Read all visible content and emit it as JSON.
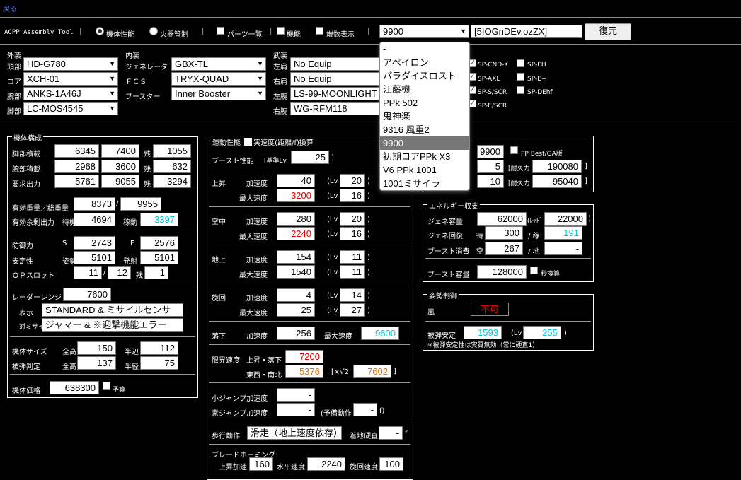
{
  "nav": {
    "back": "戻る"
  },
  "toolbar": {
    "title": "ACPP Assembly Tool",
    "radio_perf": "機体性能",
    "radio_fcs": "火器管制",
    "cb_parts": "パーツ一覧",
    "cb_func": "機能",
    "cb_decimal": "端数表示",
    "budget_value": "9900",
    "code_value": "[5IOGnDEv,ozZX]",
    "restore_button": "復元"
  },
  "dropdown": {
    "options": [
      "-",
      "アペイロン",
      "パラダイスロスト",
      "江藤機",
      "PPk 502",
      "鬼神楽",
      "9316 風重2",
      "9900",
      "初期コアPPk X3",
      "V6 PPk 1001",
      "1001ミサイラ"
    ],
    "selected": "9900"
  },
  "parts": {
    "exterior_label": "外装",
    "interior_label": "内装",
    "weapons_label": "武装",
    "head_label": "頭部",
    "head": "HD-G780",
    "core_label": "コア",
    "core": "XCH-01",
    "arms_label": "腕部",
    "arms": "ANKS-1A46J",
    "legs_label": "脚部",
    "legs": "LC-MOS4545",
    "gen_label": "ジェネレータ",
    "gen": "GBX-TL",
    "fcs_label": "ＦＣＳ",
    "fcs": "TRYX-QUAD",
    "booster_label": "ブースター",
    "booster": "Inner Booster",
    "ls_label": "左肩",
    "ls": "No Equip",
    "rs_label": "右肩",
    "rs": "No Equip",
    "la_label": "左腕",
    "la": "LS-99-MOONLIGHT",
    "ra_label": "右腕",
    "ra": "WG-RFM118"
  },
  "options": [
    "SP-CND-K",
    "SP-EH",
    "SP-AXL",
    "SP-E+",
    "SP-S/SCR",
    "SP-DEhf",
    "SP-E/SCR"
  ],
  "frame": {
    "legend": "機体構成",
    "leg_load_label": "脚部積載",
    "leg_load": "6345",
    "leg_load_max": "7400",
    "rem": "残",
    "leg_load_rem": "1055",
    "arm_load_label": "腕部積載",
    "arm_load": "2968",
    "arm_load_max": "3600",
    "arm_load_rem": "632",
    "power_label": "要求出力",
    "power": "5761",
    "power_max": "9055",
    "power_rem": "3294",
    "weight_label": "有効重量／総重量",
    "weight": "8373",
    "weight_total": "9955",
    "surplus_label": "有効余剰出力",
    "standby": "待機",
    "surplus_standby": "4694",
    "active": "稼動",
    "surplus_active": "3397",
    "defense_label": "防御力",
    "def_s": "S",
    "def_s_val": "2743",
    "def_e": "E",
    "def_e_val": "2576",
    "stability_label": "安定性",
    "posture": "姿勢",
    "stab_posture": "5101",
    "fire": "発射",
    "stab_fire": "5101",
    "op_label": "ＯＰスロット",
    "op_used": "11",
    "op_max": "12",
    "op_rem": "1",
    "radar_label": "レーダーレンジ",
    "radar": "7600",
    "display_label": "表示",
    "display": "STANDARD & ミサイルセンサー",
    "anti_missile_label": "対ミサイル",
    "anti_missile": "ジャマー & ※迎撃機能エラー",
    "size_label": "機体サイズ",
    "full_height": "全高",
    "size_full": "150",
    "half_side": "半辺",
    "size_half": "112",
    "hit_label": "被弾判定",
    "hit_full": "137",
    "radius": "半径",
    "hit_radius": "75",
    "price_label": "機体価格",
    "price": "638300",
    "budget_label": "予算"
  },
  "motion": {
    "legend": "運動性能",
    "real_speed": "実速度(距離/f)換算",
    "boost_label": "ブースト性能",
    "base_lv": "[基準Lv",
    "base_lv_val": "25",
    "close_bracket": "]",
    "accel": "加速度",
    "max_speed": "最大速度",
    "lv": "(Lv",
    "rp": ")",
    "up_label": "上昇",
    "up_accel": "40",
    "up_accel_lv": "20",
    "up_max": "3200",
    "up_max_lv": "16",
    "air_label": "空中",
    "air_accel": "280",
    "air_accel_lv": "20",
    "air_max": "2240",
    "air_max_lv": "16",
    "ground_label": "地上",
    "ground_accel": "154",
    "ground_accel_lv": "11",
    "ground_max": "1540",
    "ground_max_lv": "11",
    "turn_label": "旋回",
    "turn_accel": "4",
    "turn_accel_lv": "14",
    "turn_max": "25",
    "turn_max_lv": "27",
    "fall_label": "落下",
    "fall_accel": "256",
    "fall_max": "9600",
    "limit_label": "限界速度",
    "limit_updown": "上昇・落下",
    "limit_updown_val": "7200",
    "limit_ew": "東西・南北",
    "limit_ew_val": "5376",
    "sqrt2": "[×√2",
    "limit_sqrt_val": "7602",
    "small_jump_label": "小ジャンプ加速度",
    "small_jump": "-",
    "normal_jump_label": "素ジャンプ加速度",
    "normal_jump": "-",
    "spare_label": "(予備動作",
    "spare": "-",
    "spare_unit": "f)",
    "walk_label": "歩行動作",
    "walk": "滑走（地上速度依存）",
    "land_label": "着地硬直",
    "land": "-",
    "land_unit": "f",
    "blade_label": "ブレードホーミング",
    "blade_up_label": "上昇加速",
    "blade_up": "160",
    "blade_h_label": "水平速度",
    "blade_h": "2240",
    "blade_turn_label": "旋回速度",
    "blade_turn": "100"
  },
  "right_top": {
    "val1": "9900",
    "pp_label": "PP Best/GA版",
    "v2": "5",
    "dur_label": "[耐久力",
    "dur1": "190080",
    "rb": "]",
    "v3": "10",
    "dur2": "95040"
  },
  "energy": {
    "legend": "エネルギー収支",
    "capacity_label": "ジェネ容量",
    "capacity": "62000",
    "red_label": "(ﾚｯﾄﾞ",
    "red": "22000",
    "recovery_label": "ジェネ回復",
    "wait": "待",
    "rec_wait": "300",
    "slash_active": "/ 稼",
    "rec_active": "191",
    "consume_label": "ブースト消費",
    "air": "空",
    "consume_air": "267",
    "slash_ground": "/ 地",
    "consume_ground": "-",
    "boost_cap_label": "ブースト容量",
    "boost_cap": "128000",
    "sec_label": "秒換算"
  },
  "posture": {
    "legend": "姿勢制御",
    "wind_label": "風",
    "wind": "不可",
    "hit_stab_label": "被弾安定",
    "hit_stab": "1593",
    "lv": "(Lv",
    "hit_stab_lv": "255",
    "note": "※被弾安定性は実質無効（常に硬直1）"
  }
}
